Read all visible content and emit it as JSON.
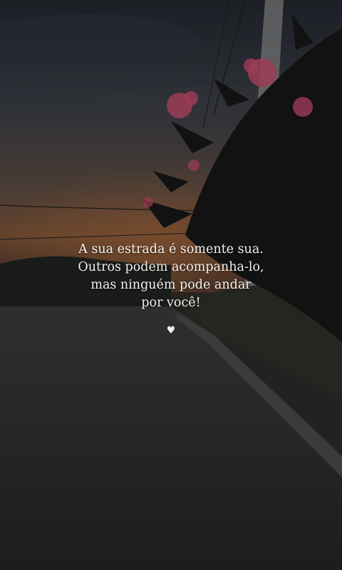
{
  "quote": {
    "lines": [
      "A sua estrada é somente sua.",
      "Outros podem acompanha-lo,",
      "mas ninguém pode andar",
      "por você!"
    ]
  },
  "heart_icon": "heart-icon",
  "colors": {
    "sky_top": "#2b2f3a",
    "sunset_glow": "#8a5a3a",
    "road": "#2d2c2e",
    "flowers": "#c04a6a",
    "text": "#f4f1ec"
  }
}
